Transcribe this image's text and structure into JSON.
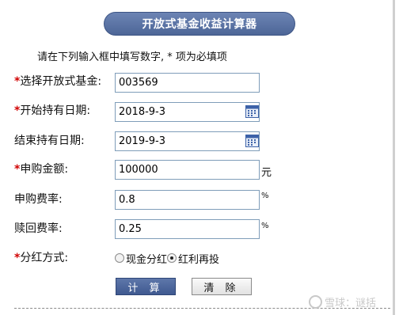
{
  "title": "开放式基金收益计算器",
  "instruction": "请在下列输入框中填写数字, * 项为必填项",
  "required_mark": "*",
  "fields": {
    "fund": {
      "label": "选择开放式基金:",
      "value": "003569"
    },
    "start_date": {
      "label": "开始持有日期:",
      "value": "2018-9-3"
    },
    "end_date": {
      "label": "结束持有日期:",
      "value": "2019-9-3"
    },
    "amount": {
      "label": "申购金额:",
      "value": "100000",
      "unit": "元"
    },
    "purchase_fee": {
      "label": "申购费率:",
      "value": "0.8",
      "unit": "%"
    },
    "redeem_fee": {
      "label": "赎回费率:",
      "value": "0.25",
      "unit": "%"
    }
  },
  "dividend": {
    "label": "分红方式:",
    "options": [
      {
        "label": "现金分红",
        "checked": false
      },
      {
        "label": "红利再投",
        "checked": true
      }
    ]
  },
  "buttons": {
    "calculate": "计 算",
    "clear": "清 除"
  },
  "watermark": "雪球：谜括"
}
